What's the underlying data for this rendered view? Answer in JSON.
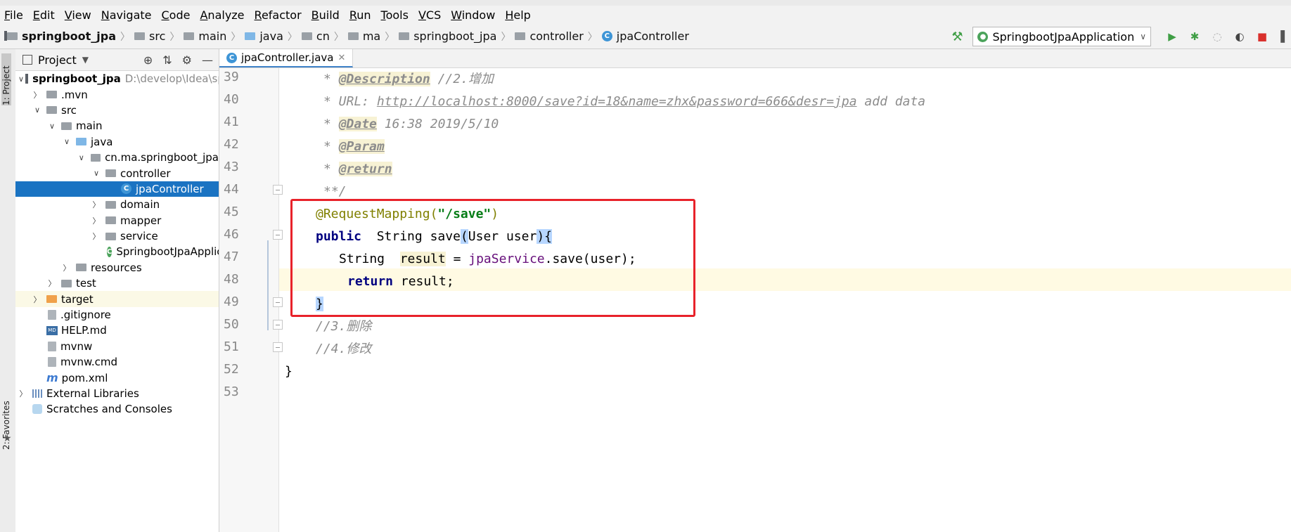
{
  "menu": [
    "File",
    "Edit",
    "View",
    "Navigate",
    "Code",
    "Analyze",
    "Refactor",
    "Build",
    "Run",
    "Tools",
    "VCS",
    "Window",
    "Help"
  ],
  "breadcrumb": [
    "springboot_jpa",
    "src",
    "main",
    "java",
    "cn",
    "ma",
    "springboot_jpa",
    "controller",
    "jpaController"
  ],
  "run_config": "SpringbootJpaApplication",
  "side_tabs": {
    "project": "1: Project",
    "favorites": "2: Favorites"
  },
  "project_panel": {
    "title": "Project"
  },
  "tree": {
    "root_name": "springboot_jpa",
    "root_path": "D:\\develop\\Idea\\spring",
    "items": [
      ".mvn",
      "src",
      "main",
      "java",
      "cn.ma.springboot_jpa",
      "controller",
      "jpaController",
      "domain",
      "mapper",
      "service",
      "SpringbootJpaApplica",
      "resources",
      "test",
      "target",
      ".gitignore",
      "HELP.md",
      "mvnw",
      "mvnw.cmd",
      "pom.xml",
      "External Libraries",
      "Scratches and Consoles"
    ]
  },
  "editor": {
    "tab": "jpaController.java",
    "line_numbers": [
      "39",
      "40",
      "41",
      "42",
      "43",
      "44",
      "45",
      "46",
      "47",
      "48",
      "49",
      "50",
      "51",
      "52",
      "53"
    ],
    "code": {
      "l39_a": "* ",
      "l39_tag": "@Description",
      "l39_b": " //2.增加",
      "l40_a": "* URL: ",
      "l40_url": "http://localhost:8000/save?id=18&name=zhx&password=666&desr=jpa",
      "l40_b": " add data",
      "l41_a": "* ",
      "l41_tag": "@Date",
      "l41_b": " 16:38 2019/5/10",
      "l42_a": "* ",
      "l42_tag": "@Param",
      "l43_a": "* ",
      "l43_tag": "@return",
      "l44": "**/",
      "l45_ann": "@RequestMapping",
      "l45_p1": "(",
      "l45_str": "\"/save\"",
      "l45_p2": ")",
      "l46_kw": "public",
      "l46_a": "  String save",
      "l46_lp": "(",
      "l46_b": "User user",
      "l46_rp": ")",
      "l46_lb": "{",
      "l47_a": "String  ",
      "l47_var": "result",
      "l47_b": " = ",
      "l47_fld": "jpaService",
      "l47_c": ".save(user);",
      "l48_kw": "return",
      "l48_a": " result;",
      "l49": "}",
      "l50": "//3.删除",
      "l51": "//4.修改",
      "l52": "}"
    }
  },
  "colors": {
    "selection": "#1a73c2",
    "highlight_box": "#e8222a",
    "keyword": "#000080",
    "annotation": "#808000",
    "string": "#067d17"
  }
}
